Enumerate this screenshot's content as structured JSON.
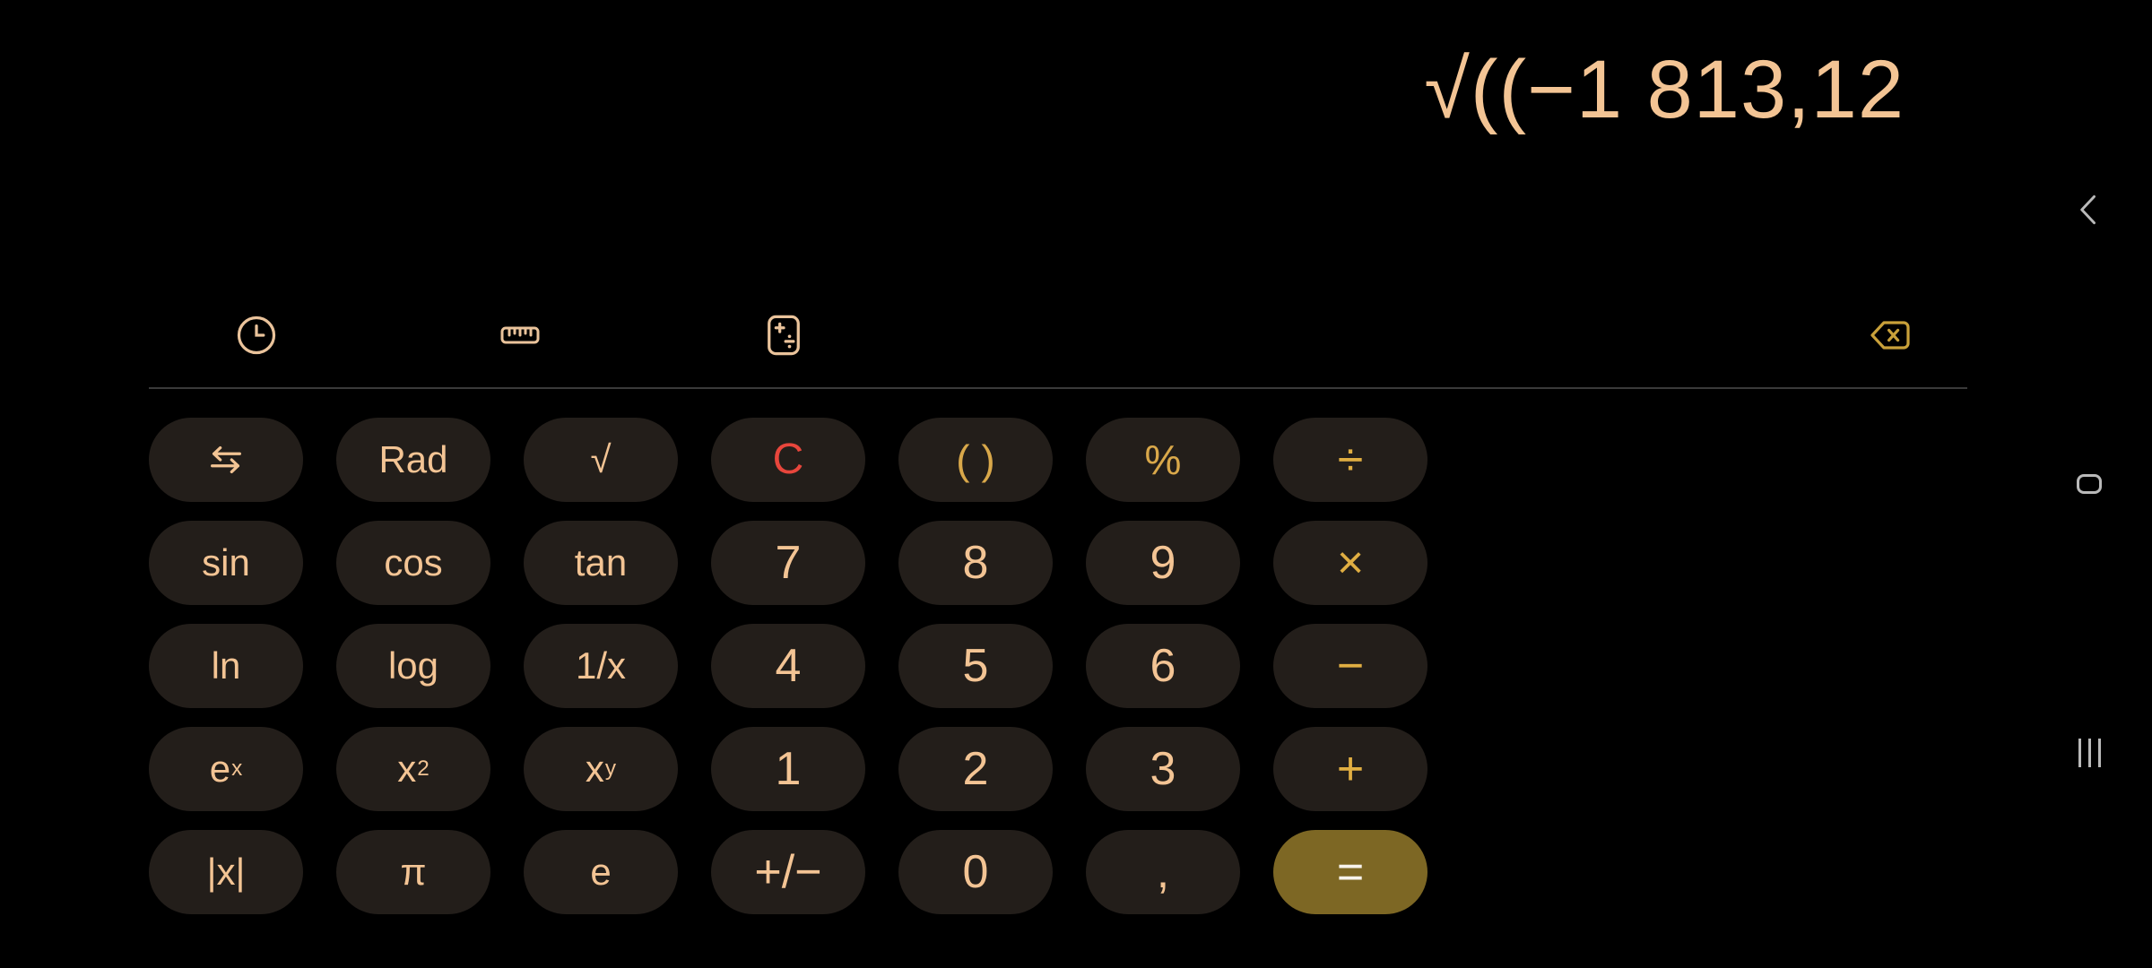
{
  "app": {
    "name": "Calculator",
    "theme": {
      "background": "#000000",
      "key_background": "#231E1A",
      "number_color": "#F3C494",
      "operator_color": "#E0AE42",
      "clear_color": "#E8463C",
      "equals_background": "#7D6724",
      "equals_color": "#F7F3EC",
      "divider_color": "#3A3A3A",
      "nav_icon_color": "#B9B9B9"
    }
  },
  "display": {
    "expression": "√((−1 813,12",
    "align": "right"
  },
  "toolbar": {
    "items": [
      {
        "name": "history",
        "icon": "clock-icon",
        "label": "History"
      },
      {
        "name": "converter",
        "icon": "ruler-icon",
        "label": "Unit converter"
      },
      {
        "name": "calculator",
        "icon": "calculator-icon",
        "label": "Calculator"
      }
    ],
    "backspace": {
      "name": "backspace",
      "icon": "backspace-icon",
      "label": "Backspace"
    }
  },
  "keypad": {
    "columns": 7,
    "rows": 5,
    "keys": [
      {
        "label": "⇆",
        "name": "swap-mode",
        "type": "fn",
        "icon": "swap-arrows-icon"
      },
      {
        "label": "Rad",
        "name": "rad",
        "type": "fn"
      },
      {
        "label": "√",
        "name": "square-root",
        "type": "fn"
      },
      {
        "label": "C",
        "name": "clear",
        "type": "clear"
      },
      {
        "label": "( )",
        "name": "parentheses",
        "type": "paren"
      },
      {
        "label": "%",
        "name": "percent",
        "type": "paren"
      },
      {
        "label": "÷",
        "name": "divide",
        "type": "op"
      },
      {
        "label": "sin",
        "name": "sine",
        "type": "fn"
      },
      {
        "label": "cos",
        "name": "cosine",
        "type": "fn"
      },
      {
        "label": "tan",
        "name": "tangent",
        "type": "fn"
      },
      {
        "label": "7",
        "name": "digit-7",
        "type": "num"
      },
      {
        "label": "8",
        "name": "digit-8",
        "type": "num"
      },
      {
        "label": "9",
        "name": "digit-9",
        "type": "num"
      },
      {
        "label": "×",
        "name": "multiply",
        "type": "op"
      },
      {
        "label": "ln",
        "name": "natural-log",
        "type": "fn"
      },
      {
        "label": "log",
        "name": "log",
        "type": "fn"
      },
      {
        "label": "1/x",
        "name": "reciprocal",
        "type": "fn"
      },
      {
        "label": "4",
        "name": "digit-4",
        "type": "num"
      },
      {
        "label": "5",
        "name": "digit-5",
        "type": "num"
      },
      {
        "label": "6",
        "name": "digit-6",
        "type": "num"
      },
      {
        "label": "−",
        "name": "subtract",
        "type": "op"
      },
      {
        "label": "e",
        "name": "e-power-x",
        "type": "fn",
        "sup": "x"
      },
      {
        "label": "x",
        "name": "x-squared",
        "type": "fn",
        "sup": "2"
      },
      {
        "label": "x",
        "name": "x-power-y",
        "type": "fn",
        "sup": "y"
      },
      {
        "label": "1",
        "name": "digit-1",
        "type": "num"
      },
      {
        "label": "2",
        "name": "digit-2",
        "type": "num"
      },
      {
        "label": "3",
        "name": "digit-3",
        "type": "num"
      },
      {
        "label": "+",
        "name": "add",
        "type": "op"
      },
      {
        "label": "|x|",
        "name": "absolute-value",
        "type": "fn"
      },
      {
        "label": "π",
        "name": "pi",
        "type": "fn"
      },
      {
        "label": "e",
        "name": "euler-number",
        "type": "fn"
      },
      {
        "label": "+/−",
        "name": "sign-toggle",
        "type": "num"
      },
      {
        "label": "0",
        "name": "digit-0",
        "type": "num"
      },
      {
        "label": ",",
        "name": "decimal-comma",
        "type": "num"
      },
      {
        "label": "=",
        "name": "equals",
        "type": "equals"
      }
    ]
  },
  "navbar": {
    "items": [
      {
        "name": "back",
        "icon": "chevron-left-icon",
        "label": "Back"
      },
      {
        "name": "home",
        "icon": "home-icon",
        "label": "Home"
      },
      {
        "name": "recent",
        "icon": "recent-apps-icon",
        "label": "Recent apps"
      }
    ]
  }
}
